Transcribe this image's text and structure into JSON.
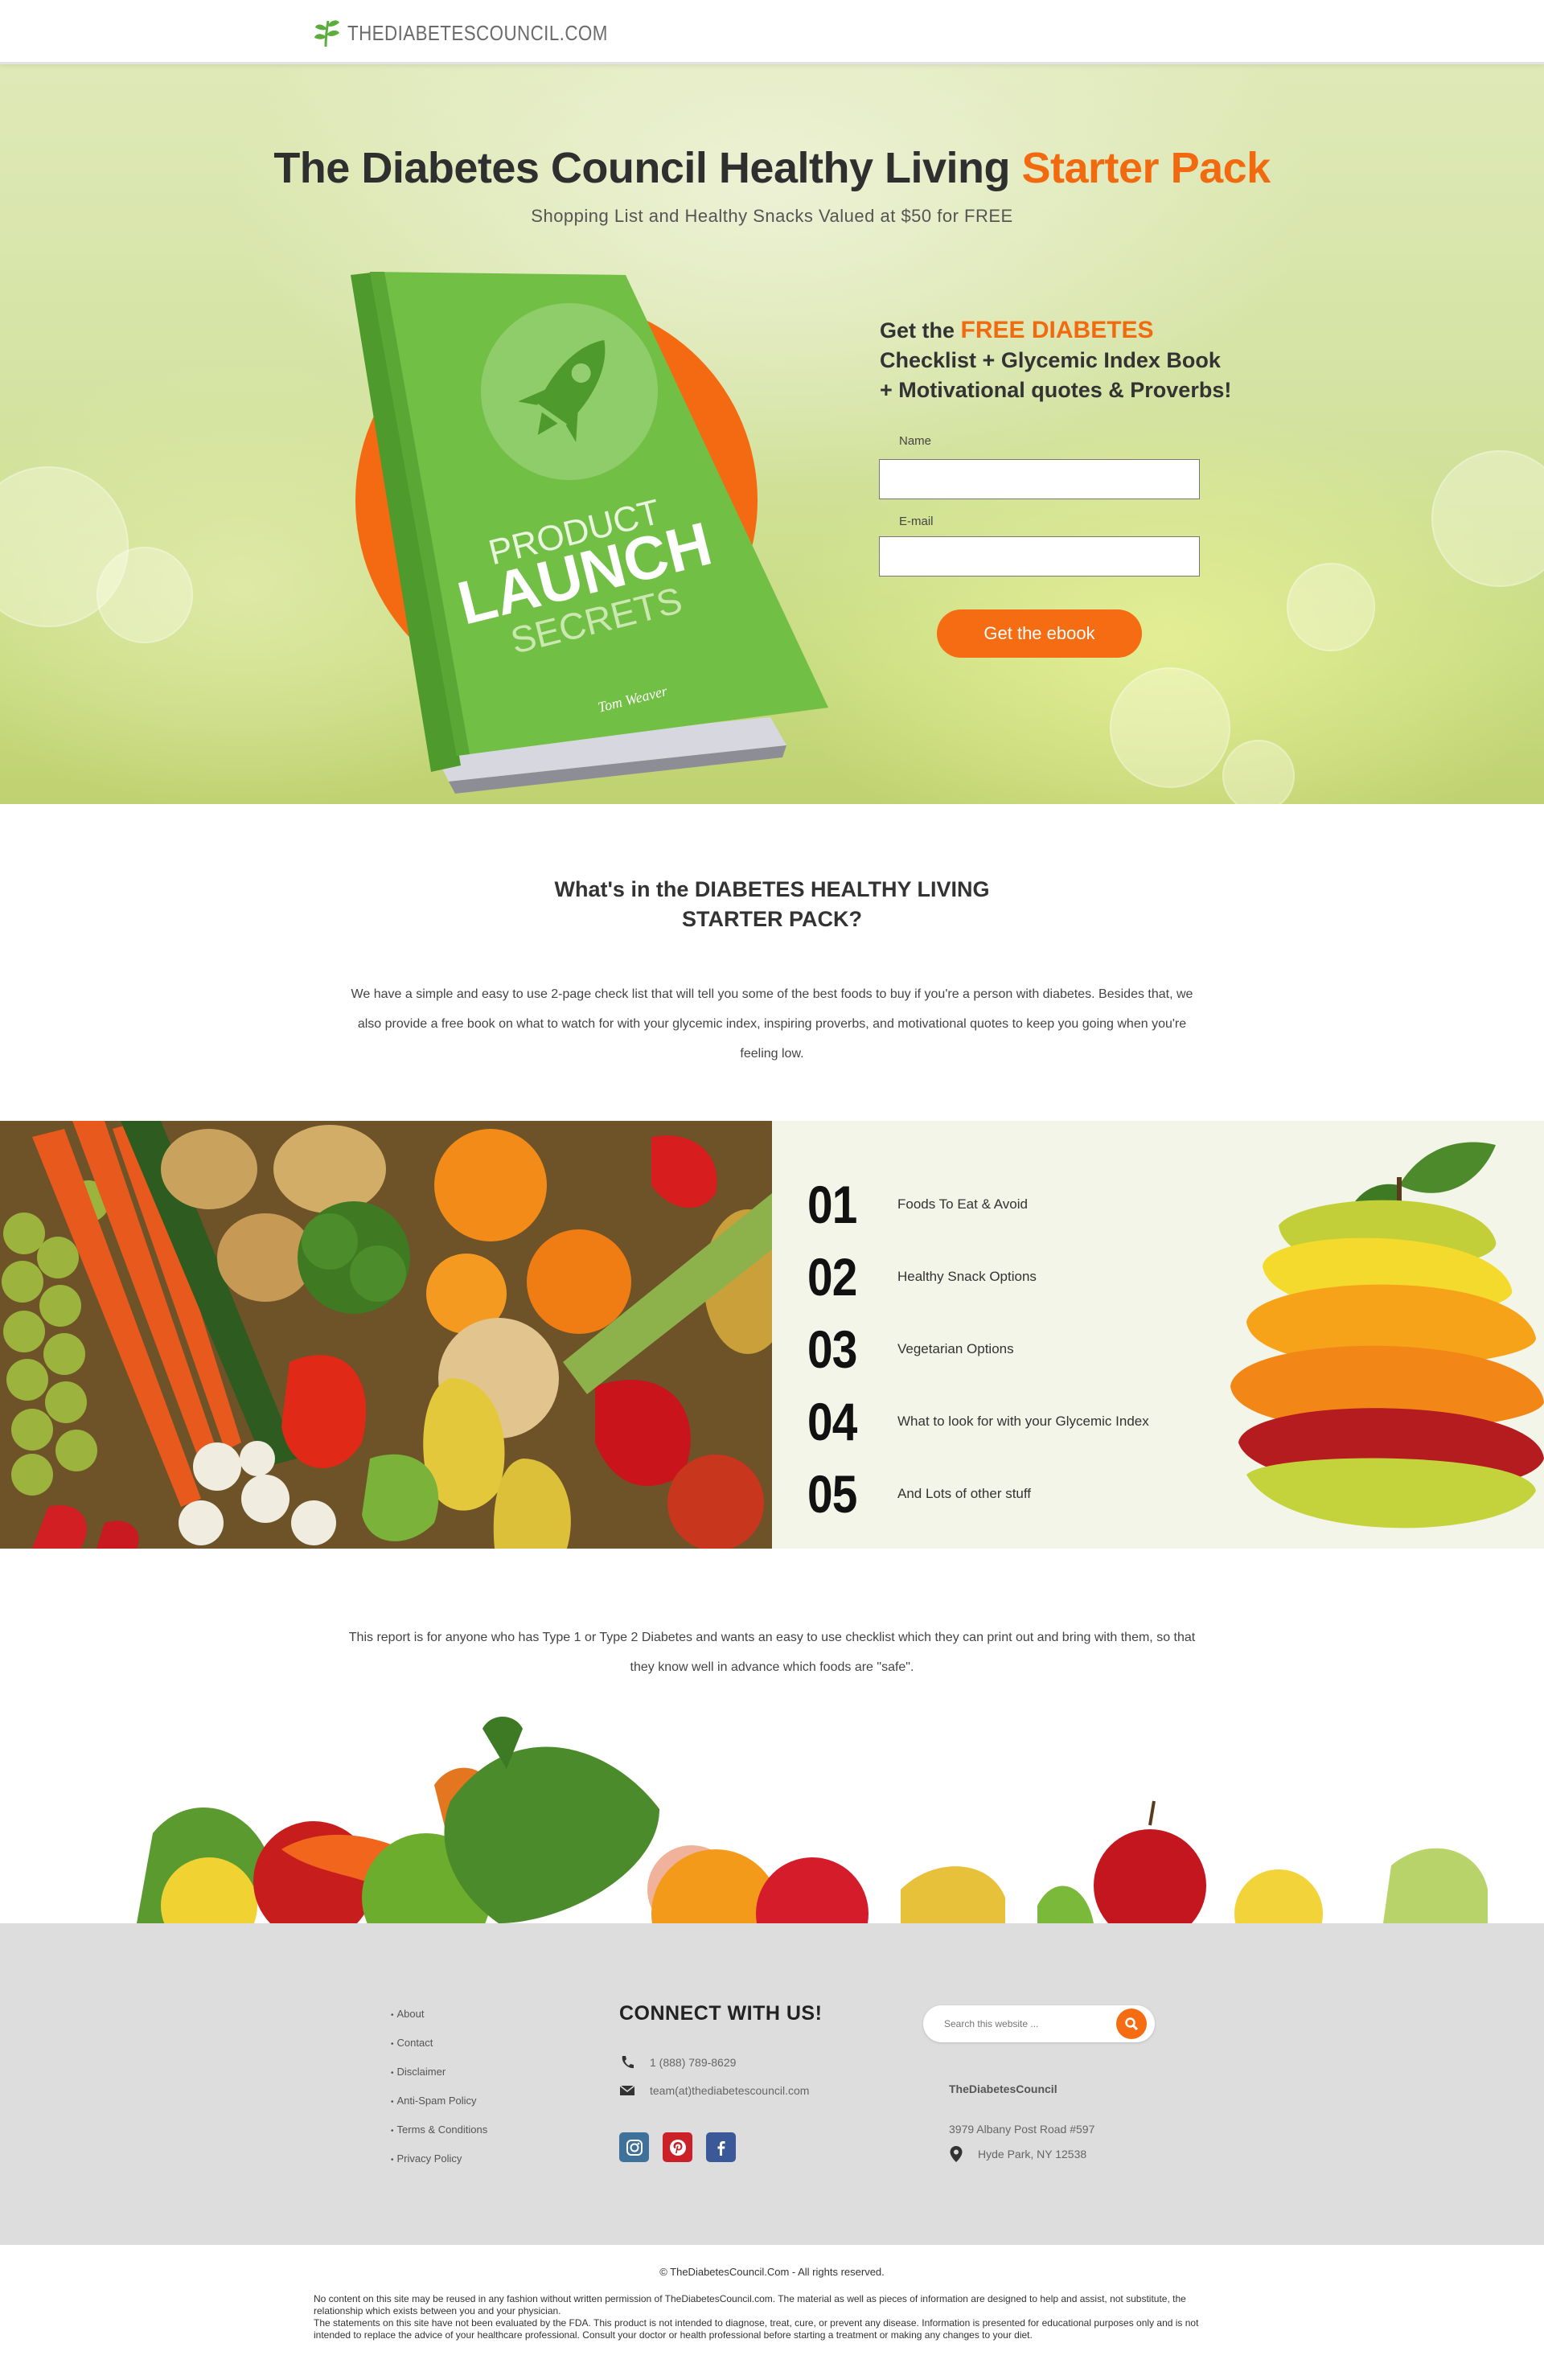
{
  "header": {
    "logo_text": "THEDIABETESCOUNCIL.COM",
    "logo_icon": "leaf-icon",
    "colors": {
      "accent": "#f26a10",
      "leaf": "#5bae3c"
    }
  },
  "hero": {
    "title_main": "The Diabetes Council Healthy Living ",
    "title_accent": "Starter Pack",
    "subtitle": "Shopping List and Healthy Snacks Valued at $50 for FREE",
    "book": {
      "title_line1": "PRODUCT",
      "title_line2": "LAUNCH",
      "title_line3": "SECRETS",
      "author": "Tom Weaver"
    },
    "form": {
      "heading_prefix": "Get the ",
      "heading_highlight": "FREE DIABETES",
      "heading_rest": "Checklist + Glycemic Index Book + Motivational quotes & Proverbs!",
      "name_label": "Name",
      "name_value": "",
      "email_label": "E-mail",
      "email_value": "",
      "submit_label": "Get the ebook"
    }
  },
  "whats_in": {
    "title_line1": "What's in the DIABETES HEALTHY LIVING",
    "title_line2": "STARTER PACK?",
    "paragraph": "We have a simple and easy to use 2-page check list that will tell you some of the best foods to buy if you're a person with diabetes. Besides that, we also provide a free book on what to watch for with your glycemic index, inspiring proverbs, and motivational quotes to keep you going when you're feeling low."
  },
  "list": [
    {
      "num": "01",
      "text": "Foods To Eat & Avoid"
    },
    {
      "num": "02",
      "text": "Healthy Snack Options"
    },
    {
      "num": "03",
      "text": "Vegetarian Options"
    },
    {
      "num": "04",
      "text": "What to look for with your Glycemic Index"
    },
    {
      "num": "05",
      "text": "And Lots of other stuff"
    }
  ],
  "report": "This report is for anyone who has Type 1 or Type 2 Diabetes and wants an easy to use checklist which they can print out and bring with them, so that they know well in advance which foods are \"safe\".",
  "footer": {
    "links": [
      "About",
      "Contact",
      "Disclaimer",
      "Anti-Spam Policy",
      "Terms & Conditions",
      "Privacy Policy"
    ],
    "connect_title": "CONNECT WITH US!",
    "phone": "1 (888) 789-8629",
    "email": "team(at)thediabetescouncil.com",
    "socials": [
      "instagram-icon",
      "pinterest-icon",
      "facebook-icon"
    ],
    "search_placeholder": "Search this website ...",
    "org_name": "TheDiabetesCouncil",
    "address_line1": "3979 Albany Post Road #597",
    "address_line2": "Hyde Park, NY 12538"
  },
  "bottom": {
    "copyright": "© TheDiabetesCouncil.Com - All rights reserved.",
    "disclaimer1": "No content on this site may be reused in any fashion without written permission of TheDiabetesCouncil.com. The material as well as pieces of information are designed to help and assist, not substitute, the relationship which exists between you and your physician.",
    "disclaimer2": "The statements on this site have not been evaluated by the FDA. This product is not intended to diagnose, treat, cure, or prevent any disease. Information is presented for educational purposes only and is not intended to replace the advice of your healthcare professional. Consult your doctor or health professional before starting a treatment or making any changes to your diet."
  }
}
